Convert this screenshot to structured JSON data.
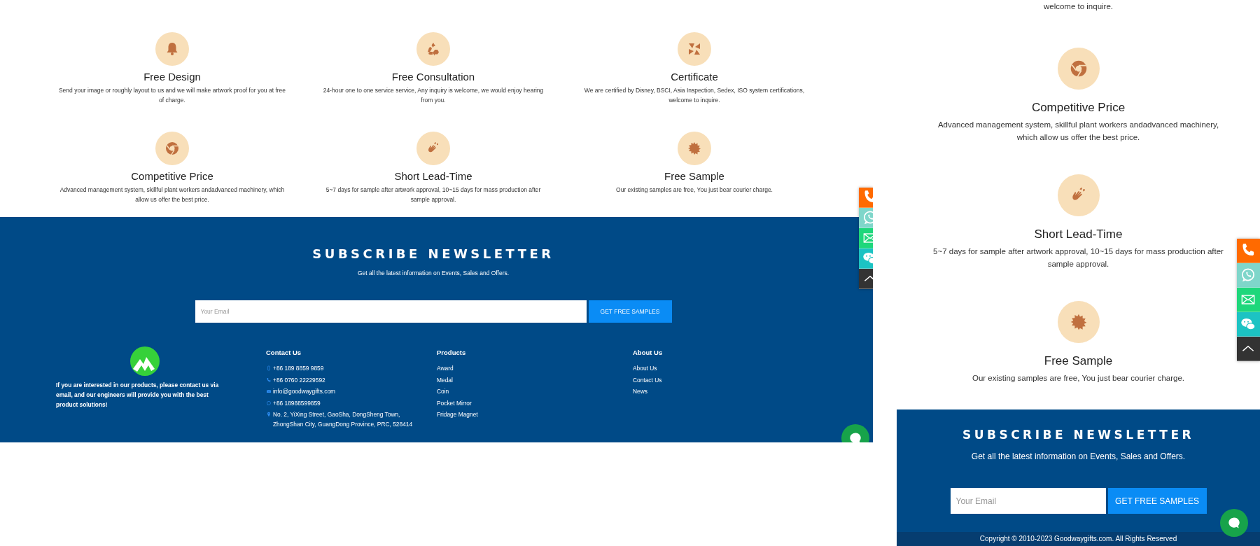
{
  "desktop": {
    "features": [
      {
        "title": "Free Design",
        "text": "Send your image or roughly layout to us and we will make artwork proof for you at free of charge."
      },
      {
        "title": "Free Consultation",
        "text": "24-hour one to one service service, Any inquiry is welcome, we would enjoy hearing from you."
      },
      {
        "title": "Certificate",
        "text": "We are certified by Disney, BSCI, Asia Inspection, Sedex, ISO system certifications, welcome to inquire."
      },
      {
        "title": "Competitive Price",
        "text": "Advanced management system, skillful plant workers andadvanced machinery, which allow us offer the best price."
      },
      {
        "title": "Short Lead-Time",
        "text": "5~7 days for sample after artwork approval, 10~15 days for mass production after sample approval."
      },
      {
        "title": "Free Sample",
        "text": "Our existing samples are free, You just bear courier charge."
      }
    ],
    "newsletter": {
      "title": "SUBSCRIBE NEWSLETTER",
      "subtitle": "Get all the latest information on Events, Sales and Offers.",
      "email": {
        "placeholder": "Your Email"
      },
      "button": "GET FREE SAMPLES"
    },
    "footer": {
      "about_text": "If you are interested in our products, please contact us via email, and our engineers will provide you with the best product solutions!",
      "columns": [
        {
          "heading": "Contact Us",
          "items": [
            "+86 189 8859 9859",
            "+86 0760 22229592",
            "info@goodwaygifts.com",
            "+86 18988599859",
            "No. 2, YiXing Street, GaoSha, DongSheng Town, ZhongShan City, GuangDong Province, PRC, 528414"
          ]
        },
        {
          "heading": "Products",
          "items": [
            "Award",
            "Medal",
            "Coin",
            "Pocket Mirror",
            "Fridage Magnet"
          ]
        },
        {
          "heading": "About Us",
          "items": [
            "About Us",
            "Contact Us",
            "News"
          ]
        }
      ]
    }
  },
  "mobile": {
    "cut_text": "welcome to inquire.",
    "features": [
      {
        "title": "Competitive Price",
        "text": "Advanced management system, skillful plant workers andadvanced machinery, which allow us offer the best price."
      },
      {
        "title": "Short Lead-Time",
        "text": "5~7 days for sample after artwork approval, 10~15 days for mass production after sample approval."
      },
      {
        "title": "Free Sample",
        "text": "Our existing samples are free, You just bear courier charge."
      }
    ],
    "newsletter": {
      "title": "SUBSCRIBE NEWSLETTER",
      "subtitle": "Get all the latest information on Events, Sales and Offers.",
      "email": {
        "placeholder": "Your Email"
      },
      "button": "GET FREE SAMPLES"
    },
    "copyright": "Copyright © 2010-2023 Goodwaygifts.com. All Rights Reserved"
  }
}
